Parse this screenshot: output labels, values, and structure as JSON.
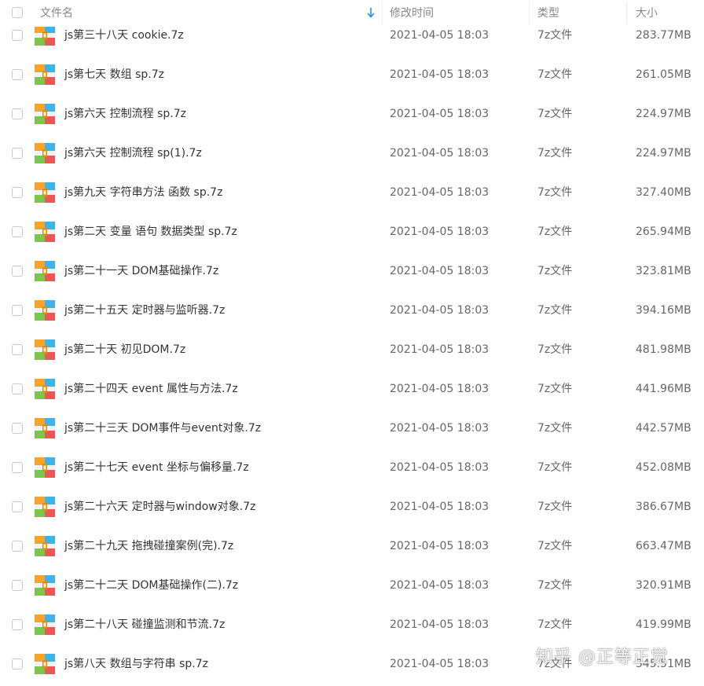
{
  "header": {
    "name": "文件名",
    "modified": "修改时间",
    "type": "类型",
    "size": "大小"
  },
  "files": [
    {
      "name": "js第三十八天 cookie.7z",
      "time": "2021-04-05 18:03",
      "type": "7z文件",
      "size": "283.77MB"
    },
    {
      "name": "js第七天 数组 sp.7z",
      "time": "2021-04-05 18:03",
      "type": "7z文件",
      "size": "261.05MB"
    },
    {
      "name": "js第六天 控制流程 sp.7z",
      "time": "2021-04-05 18:03",
      "type": "7z文件",
      "size": "224.97MB"
    },
    {
      "name": "js第六天 控制流程 sp(1).7z",
      "time": "2021-04-05 18:03",
      "type": "7z文件",
      "size": "224.97MB"
    },
    {
      "name": "js第九天 字符串方法 函数 sp.7z",
      "time": "2021-04-05 18:03",
      "type": "7z文件",
      "size": "327.40MB"
    },
    {
      "name": "js第二天 变量 语句 数据类型 sp.7z",
      "time": "2021-04-05 18:03",
      "type": "7z文件",
      "size": "265.94MB"
    },
    {
      "name": "js第二十一天 DOM基础操作.7z",
      "time": "2021-04-05 18:03",
      "type": "7z文件",
      "size": "323.81MB"
    },
    {
      "name": "js第二十五天 定时器与监听器.7z",
      "time": "2021-04-05 18:03",
      "type": "7z文件",
      "size": "394.16MB"
    },
    {
      "name": "js第二十天 初见DOM.7z",
      "time": "2021-04-05 18:03",
      "type": "7z文件",
      "size": "481.98MB"
    },
    {
      "name": "js第二十四天 event 属性与方法.7z",
      "time": "2021-04-05 18:03",
      "type": "7z文件",
      "size": "441.96MB"
    },
    {
      "name": "js第二十三天 DOM事件与event对象.7z",
      "time": "2021-04-05 18:03",
      "type": "7z文件",
      "size": "442.57MB"
    },
    {
      "name": "js第二十七天 event 坐标与偏移量.7z",
      "time": "2021-04-05 18:03",
      "type": "7z文件",
      "size": "452.08MB"
    },
    {
      "name": "js第二十六天 定时器与window对象.7z",
      "time": "2021-04-05 18:03",
      "type": "7z文件",
      "size": "386.67MB"
    },
    {
      "name": "js第二十九天 拖拽碰撞案例(完).7z",
      "time": "2021-04-05 18:03",
      "type": "7z文件",
      "size": "663.47MB"
    },
    {
      "name": "js第二十二天 DOM基础操作(二).7z",
      "time": "2021-04-05 18:03",
      "type": "7z文件",
      "size": "320.91MB"
    },
    {
      "name": "js第二十八天 碰撞监测和节流.7z",
      "time": "2021-04-05 18:03",
      "type": "7z文件",
      "size": "419.99MB"
    },
    {
      "name": "js第八天 数组与字符串 sp.7z",
      "time": "2021-04-05 18:03",
      "type": "7z文件",
      "size": "345.51MB"
    }
  ],
  "watermark": "知乎 @正等正觉",
  "colors": {
    "header_text": "#888888",
    "name_text": "#333333",
    "meta_text": "#666666",
    "sort_arrow": "#2e8ae6"
  },
  "icons": {
    "sort": "arrow-down-icon",
    "file": "zip-archive-icon",
    "select": "checkbox-icon"
  }
}
